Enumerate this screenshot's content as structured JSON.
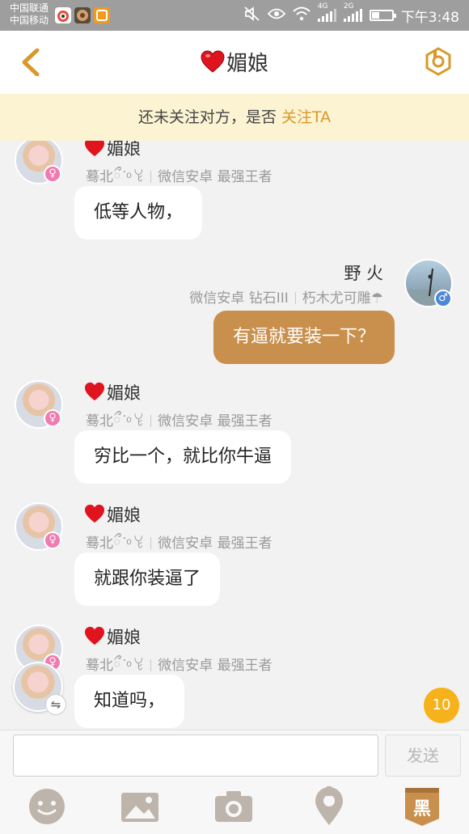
{
  "status_bar": {
    "carrier_1": "中国联通",
    "carrier_2": "中国移动",
    "network_4g": "4G",
    "network_2g": "2G",
    "time": "下午3:48",
    "battery_level": 0.35,
    "icons": [
      "weibo-icon",
      "game-app-icon",
      "app-icon",
      "mute-icon",
      "eye-icon",
      "wifi-icon",
      "signal-icon",
      "signal-icon",
      "battery-icon"
    ]
  },
  "header": {
    "title": "媚娘",
    "back_icon": "chevron-left-icon",
    "profile_icon": "profile-menu-icon",
    "accent_color": "#d79a2a"
  },
  "follow_banner": {
    "text": "还未关注对方，是否",
    "link": "关注TA"
  },
  "messages": [
    {
      "side": "left",
      "name": "媚娘",
      "tag": "蓦北ྀ ͘ ͦ ꒀ",
      "platform": "微信安卓",
      "rank": "最强王者",
      "text": "低等人物，",
      "gender": "♀"
    },
    {
      "side": "right",
      "name": "野 火",
      "tag": "朽木尤可雕☂",
      "platform": "微信安卓",
      "rank": "钻石III",
      "text": "有逼就要装一下？",
      "gender": "♂"
    },
    {
      "side": "left",
      "name": "媚娘",
      "tag": "蓦北ྀ ͘ ͦ ꒀ",
      "platform": "微信安卓",
      "rank": "最强王者",
      "text": "穷比一个，就比你牛逼",
      "gender": "♀"
    },
    {
      "side": "left",
      "name": "媚娘",
      "tag": "蓦北ྀ ͘ ͦ ꒀ",
      "platform": "微信安卓",
      "rank": "最强王者",
      "text": "就跟你装逼了",
      "gender": "♀"
    },
    {
      "side": "left",
      "name": "媚娘",
      "tag": "蓦北ྀ ͘ ͦ ꒀ",
      "platform": "微信安卓",
      "rank": "最强王者",
      "text": "知道吗，",
      "gender": "♀"
    }
  ],
  "unread_count": "10",
  "input": {
    "value": "",
    "placeholder": "",
    "send_label": "发送"
  },
  "toolbar": {
    "items": [
      "emoji-icon",
      "image-icon",
      "camera-icon",
      "location-icon",
      "blacklist-icon"
    ],
    "blacklist_label": "黑"
  }
}
